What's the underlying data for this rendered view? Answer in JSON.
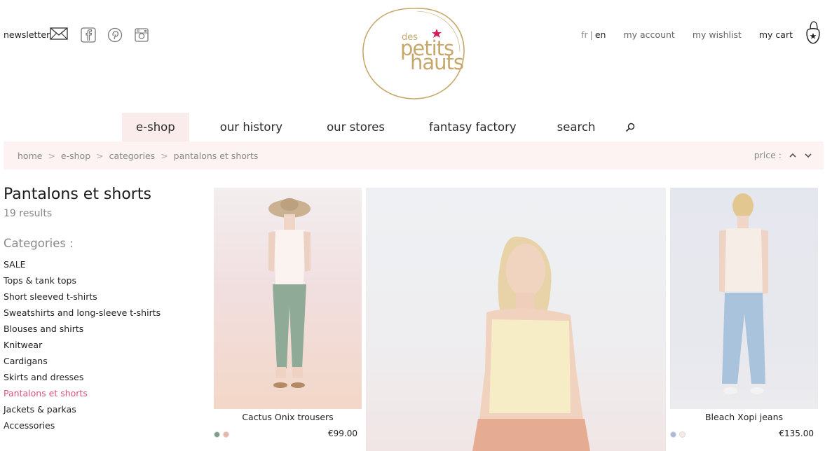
{
  "header": {
    "newsletter_label": "newsletter",
    "social_icons": [
      "facebook-icon",
      "pinterest-icon",
      "instagram-icon"
    ],
    "logo": {
      "line1": "des",
      "line2": "petits",
      "line3": "hauts"
    },
    "lang": {
      "fr": "fr",
      "sep": "|",
      "en": "en"
    },
    "account_label": "my account",
    "wishlist_label": "my wishlist",
    "cart_label": "my cart"
  },
  "nav": {
    "items": [
      {
        "label": "e-shop",
        "active": true
      },
      {
        "label": "our history"
      },
      {
        "label": "our stores"
      },
      {
        "label": "fantasy factory"
      },
      {
        "label": "search"
      }
    ]
  },
  "breadcrumb": {
    "items": [
      "home",
      "e-shop",
      "categories",
      "pantalons et shorts"
    ],
    "separator": ">"
  },
  "sort": {
    "label": "price :"
  },
  "sidebar": {
    "title": "Pantalons et shorts",
    "results": "19 results",
    "categories_heading": "Categories :",
    "categories": [
      "SALE",
      "Tops & tank tops",
      "Short sleeved t-shirts",
      "Sweatshirts and long-sleeve t-shirts",
      "Blouses and shirts",
      "Knitwear",
      "Cardigans",
      "Skirts and dresses",
      "Pantalons et shorts",
      "Jackets & parkas",
      "Accessories"
    ],
    "active_category": "Pantalons et shorts"
  },
  "products": [
    {
      "name": "Cactus Onix trousers",
      "price": "€99.00",
      "swatches": [
        "#7a9d89",
        "#e8b7a8"
      ]
    },
    {
      "name": "",
      "price": "",
      "swatches": []
    },
    {
      "name": "Bleach Xopi jeans",
      "price": "€135.00",
      "swatches": [
        "#aab7d8",
        "#f6e9e6"
      ]
    }
  ],
  "colors": {
    "accent_pink": "#d9537a",
    "nav_active_bg": "#fbecec",
    "crumb_bar_bg": "#fdf3f3",
    "logo_gold": "#c7a86a",
    "logo_star": "#d81b56"
  }
}
